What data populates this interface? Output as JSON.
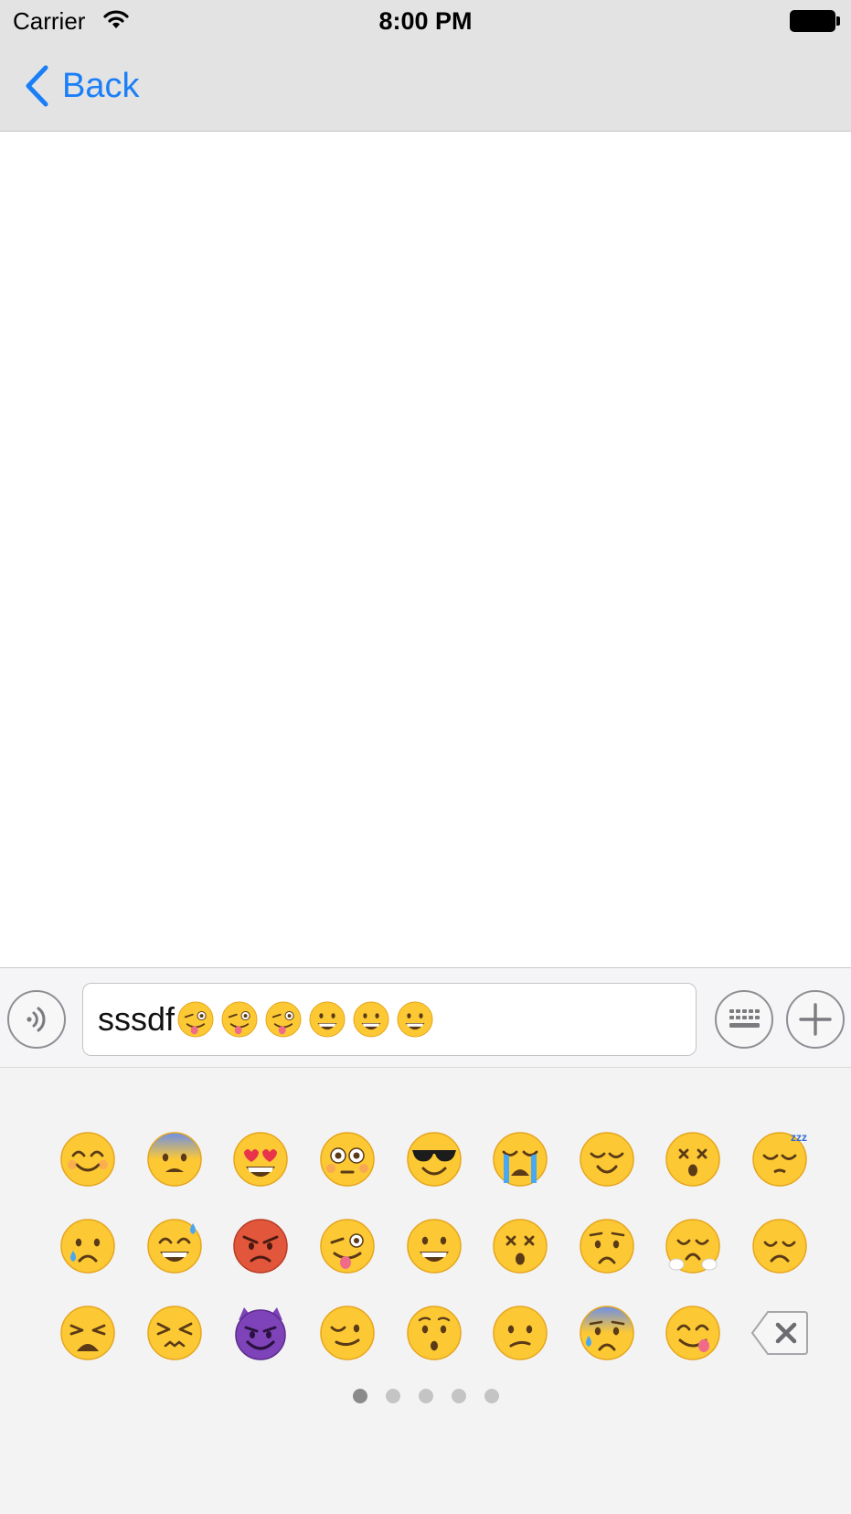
{
  "status_bar": {
    "carrier": "Carrier",
    "time": "8:00 PM"
  },
  "nav": {
    "back_label": "Back"
  },
  "input": {
    "text": "sssdf"
  },
  "colors": {
    "accent": "#1a7ff7",
    "face": "#fcc934",
    "angry": "#e2573c",
    "devil": "#7f43b9"
  },
  "input_emojis": [
    "tongue-wink",
    "tongue-wink",
    "tongue-wink",
    "grin",
    "grin",
    "grin"
  ],
  "emoji_grid": [
    [
      "smile-blush",
      "fearful-blue",
      "heart-eyes",
      "flushed",
      "sunglasses",
      "loud-cry",
      "relieved",
      "dizzy",
      "sleeping"
    ],
    [
      "crying-tear",
      "sweat-smile",
      "angry-red",
      "tongue-wink",
      "grin",
      "astonished-dizzy",
      "worried",
      "triumph",
      "disappointed"
    ],
    [
      "tired",
      "confounded",
      "smiling-devil",
      "wink",
      "hushed",
      "confused",
      "cold-sweat",
      "yum",
      "delete"
    ]
  ],
  "page_control": {
    "pages": 5,
    "current": 0
  }
}
